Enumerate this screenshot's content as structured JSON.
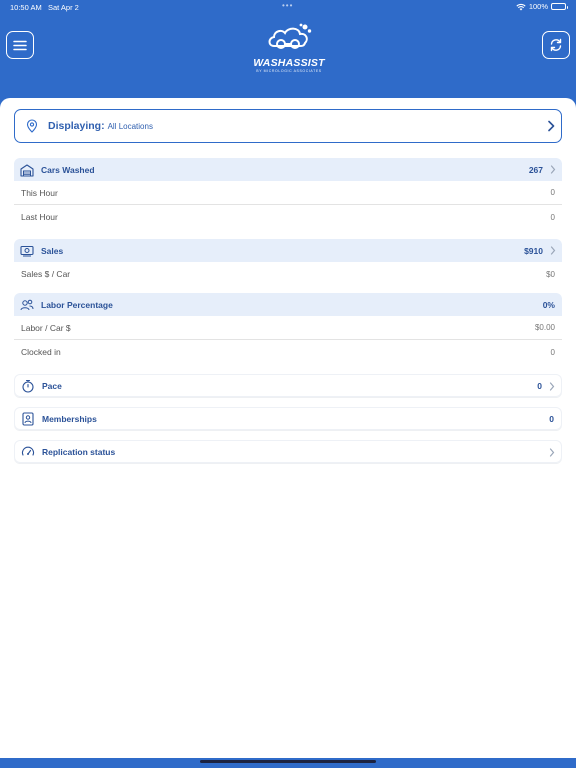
{
  "status_bar": {
    "time": "10:50 AM",
    "date": "Sat Apr 2",
    "battery": "100%"
  },
  "header": {
    "logo_text": "WASHASSIST",
    "logo_sub": "BY MICROLOGIC ASSOCIATES"
  },
  "location": {
    "label": "Displaying:",
    "value": "All Locations"
  },
  "cars_washed": {
    "title": "Cars Washed",
    "value": "267",
    "rows": [
      {
        "label": "This Hour",
        "value": "0"
      },
      {
        "label": "Last Hour",
        "value": "0"
      }
    ]
  },
  "sales": {
    "title": "Sales",
    "value": "$910",
    "rows": [
      {
        "label": "Sales $ / Car",
        "value": "$0"
      }
    ]
  },
  "labor": {
    "title": "Labor Percentage",
    "value": "0%",
    "rows": [
      {
        "label": "Labor / Car $",
        "value": "$0.00"
      },
      {
        "label": "Clocked in",
        "value": "0"
      }
    ]
  },
  "pace": {
    "title": "Pace",
    "value": "0"
  },
  "memberships": {
    "title": "Memberships",
    "value": "0"
  },
  "replication": {
    "title": "Replication status"
  },
  "colors": {
    "brand": "#2f6bc9",
    "header_tint": "#e6eefa",
    "text_blue": "#2b5298"
  },
  "icons": {
    "menu": "hamburger-icon",
    "sync": "sync-icon",
    "location": "map-pin-icon",
    "cars": "garage-icon",
    "sales": "cash-icon",
    "labor": "people-icon",
    "pace": "stopwatch-icon",
    "memberships": "member-card-icon",
    "replication": "gauge-icon",
    "chevron": "chevron-right-icon"
  }
}
